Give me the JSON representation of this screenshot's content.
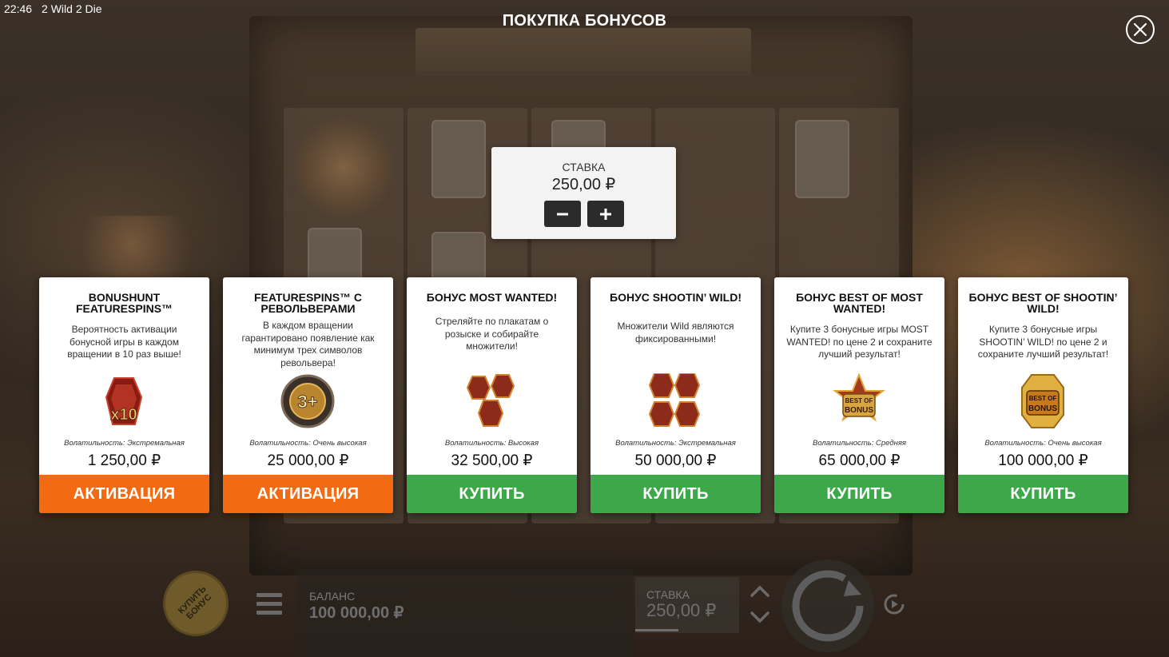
{
  "status": {
    "time": "22:46",
    "app_title": "2 Wild 2 Die"
  },
  "modal": {
    "title": "ПОКУПКА БОНУСОВ"
  },
  "stake": {
    "label": "СТАВКА",
    "value": "250,00 ₽"
  },
  "cards": [
    {
      "title": "BONUSHUNT FEATURESPINS™",
      "description": "Вероятность активации бонусной игры в каждом вращении в 10 раз выше!",
      "icon": "x10-bonushunt-icon",
      "volatility": "Волатильность: Экстремальная",
      "price": "1 250,00 ₽",
      "button": "АКТИВАЦИЯ",
      "button_color": "#f26a12"
    },
    {
      "title": "FEATURESPINS™ С РЕВОЛЬВЕРАМИ",
      "description": "В каждом вращении гарантировано появление как минимум трех символов револьвера!",
      "icon": "revolver-3plus-icon",
      "volatility": "Волатильность: Очень высокая",
      "price": "25 000,00 ₽",
      "button": "АКТИВАЦИЯ",
      "button_color": "#f26a12"
    },
    {
      "title": "БОНУС MOST WANTED!",
      "description": "Стреляйте по плакатам о розыске и собирайте множители!",
      "icon": "most-wanted-bonus-icon",
      "volatility": "Волатильность: Высокая",
      "price": "32 500,00 ₽",
      "button": "КУПИТЬ",
      "button_color": "#3da849"
    },
    {
      "title": "БОНУС SHOOTIN’ WILD!",
      "description": "Множители Wild являются фиксированными!",
      "icon": "shootin-wild-bonus-icon",
      "volatility": "Волатильность: Экстремальная",
      "price": "50 000,00 ₽",
      "button": "КУПИТЬ",
      "button_color": "#3da849"
    },
    {
      "title": "БОНУС BEST OF MOST WANTED!",
      "description": "Купите 3 бонусные игры MOST WANTED! по цене 2 и сохраните лучший результат!",
      "icon": "best-of-bonus-icon",
      "volatility": "Волатильность: Средняя",
      "price": "65 000,00 ₽",
      "button": "КУПИТЬ",
      "button_color": "#3da849"
    },
    {
      "title": "БОНУС BEST OF SHOOTIN’ WILD!",
      "description": "Купите 3 бонусные игры SHOOTIN’ WILD! по цене 2 и сохраните лучший результат!",
      "icon": "best-of-bonus-gold-icon",
      "volatility": "Волатильность: Очень высокая",
      "price": "100 000,00 ₽",
      "button": "КУПИТЬ",
      "button_color": "#3da849"
    }
  ],
  "icon_text": {
    "x10": "x10",
    "three_plus": "3+",
    "best_of": "BEST OF",
    "bonus": "BONUS"
  },
  "bottom_bar": {
    "buy_bonus": "КУПИТЬ БОНУС",
    "balance_label": "БАЛАНС",
    "balance_value": "100 000,00 ₽",
    "bet_label": "СТАВКА",
    "bet_value": "250,00 ₽"
  }
}
